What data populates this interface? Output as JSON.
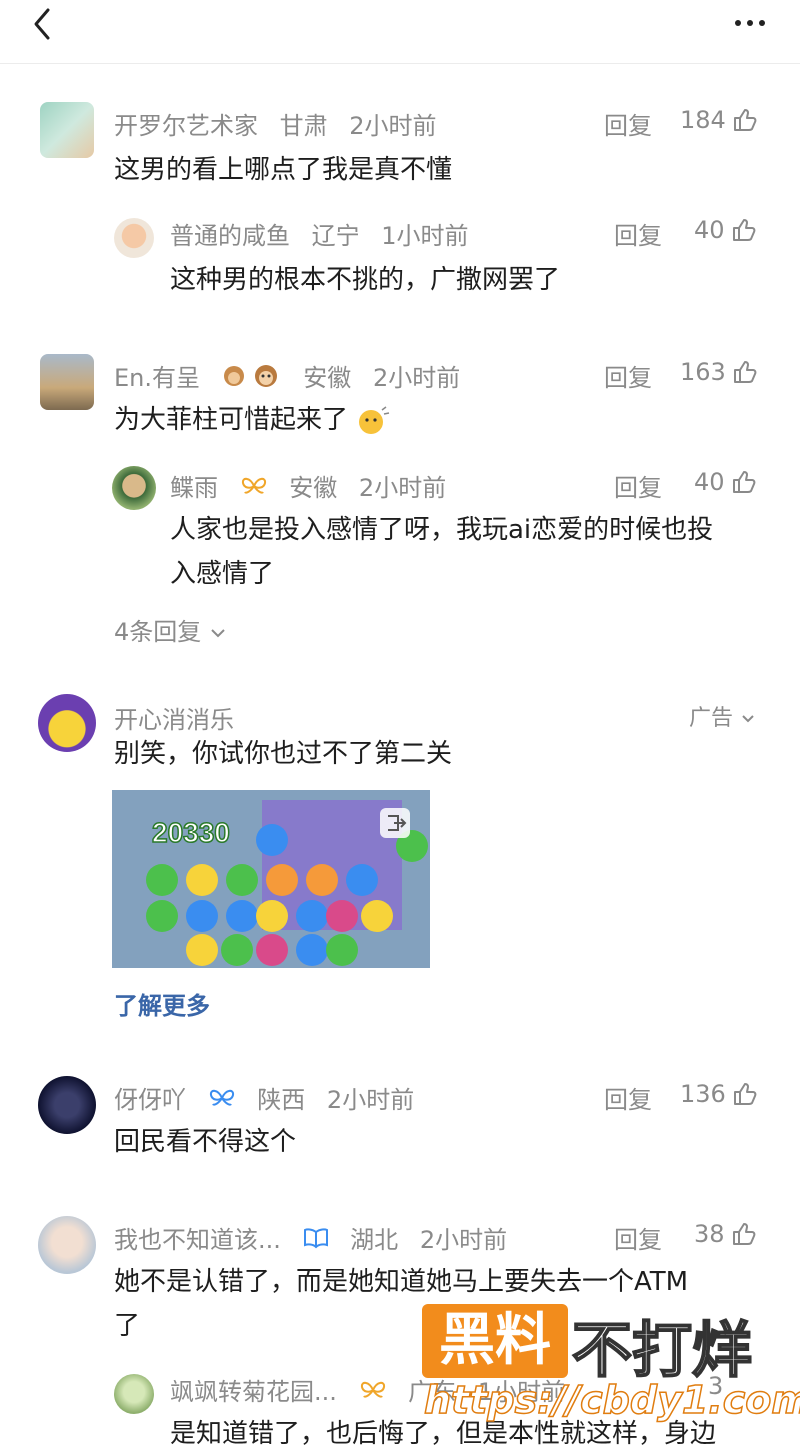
{
  "colors": {
    "accent_link": "#3a66a8",
    "meta_gray": "#8a8a8a",
    "watermark_orange": "#f28c1c"
  },
  "comments": [
    {
      "user": "开罗尔艺术家",
      "region": "甘肃",
      "time": "2小时前",
      "reply": "回复",
      "likes": "184",
      "text": "这男的看上哪点了我是真不懂"
    },
    {
      "user": "普通的咸鱼",
      "region": "辽宁",
      "time": "1小时前",
      "reply": "回复",
      "likes": "40",
      "text": "这种男的根本不挑的，广撒网罢了"
    },
    {
      "user": "En.有呈",
      "region": "安徽",
      "time": "2小时前",
      "reply": "回复",
      "likes": "163",
      "text": "为大菲柱可惜起来了"
    },
    {
      "user": "鲽雨",
      "region": "安徽",
      "time": "2小时前",
      "reply": "回复",
      "likes": "40",
      "text_line1": "人家也是投入感情了呀，我玩ai恋爱的时候也投",
      "text_line2": "入感情了"
    },
    {
      "user": "伢伢吖",
      "region": "陕西",
      "time": "2小时前",
      "reply": "回复",
      "likes": "136",
      "text": "回民看不得这个"
    },
    {
      "user": "我也不知道该...",
      "region": "湖北",
      "time": "2小时前",
      "reply": "回复",
      "likes": "38",
      "text_line1": "她不是认错了，而是她知道她马上要失去一个ATM",
      "text_line2": "了"
    },
    {
      "user": "飒飒转菊花园...",
      "region": "广东",
      "time": "1小时前",
      "likes": "3",
      "text": "是知道错了，也后悔了，但是本性就这样，身边"
    }
  ],
  "more_replies": "4条回复",
  "ad": {
    "name": "开心消消乐",
    "label": "广告",
    "text": "别笑，你试你也过不了第二关",
    "learn_more": "了解更多",
    "game_score": "20330"
  },
  "watermark": {
    "box": "黑料",
    "title": "不打烊",
    "url": "https://cbdy1.com"
  }
}
